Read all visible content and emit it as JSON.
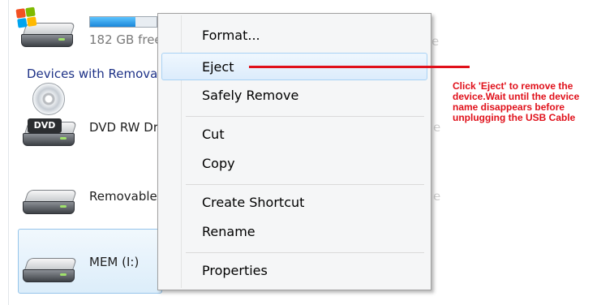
{
  "drives": {
    "system": {
      "free_text": "182 GB free",
      "storage_fraction": 0.68
    },
    "dvd": {
      "name": "DVD RW Drive",
      "badge": "DVD"
    },
    "removable": {
      "name": "Removable Disk"
    },
    "mem": {
      "name": "MEM (I:)"
    }
  },
  "sections": {
    "devices_header": "Devices with Removable Storage"
  },
  "context_menu": {
    "items": [
      {
        "label": "Format..."
      },
      {
        "label": "Eject"
      },
      {
        "label": "Safely Remove"
      },
      {
        "label": "Cut"
      },
      {
        "label": "Copy"
      },
      {
        "label": "Create Shortcut"
      },
      {
        "label": "Rename"
      },
      {
        "label": "Properties"
      }
    ],
    "highlighted": "Eject"
  },
  "annotation": {
    "text": "Click 'Eject' to remove the device.Wait until the device name disappears before unplugging the USB Cable",
    "color": "#e0101a"
  },
  "colors": {
    "section_header": "#1e3287",
    "selection_border": "#94c4ea",
    "menu_highlight_border": "#a9d2f4"
  }
}
